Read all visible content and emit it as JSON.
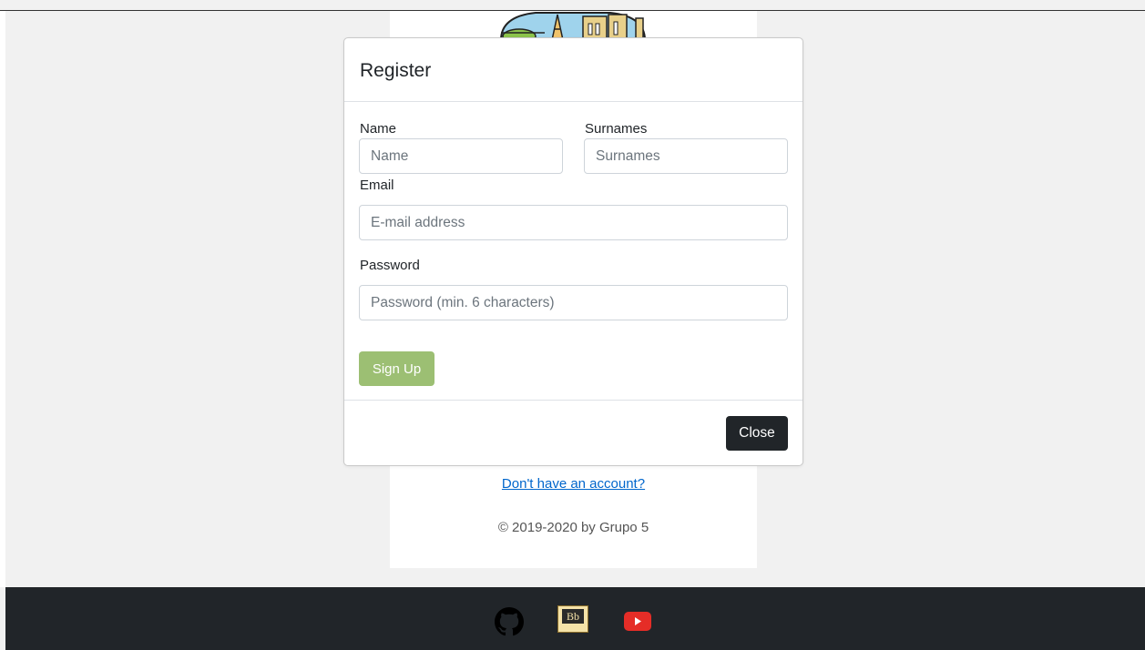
{
  "modal": {
    "title": "Register",
    "fields": {
      "name": {
        "label": "Name",
        "placeholder": "Name"
      },
      "surnames": {
        "label": "Surnames",
        "placeholder": "Surnames"
      },
      "email": {
        "label": "Email",
        "placeholder": "E-mail address"
      },
      "password": {
        "label": "Password",
        "placeholder": "Password (min. 6 characters)"
      }
    },
    "signup_label": "Sign Up",
    "close_label": "Close"
  },
  "page": {
    "account_link": "Don't have an account?",
    "copyright": "© 2019-2020 by Grupo 5"
  },
  "footer": {
    "icons": [
      "github-icon",
      "blackboard-icon",
      "youtube-icon"
    ],
    "blackboard_badge": "Bb"
  },
  "colors": {
    "signup_button": "#9cbf73",
    "close_button": "#212529",
    "footer_bg": "#212529",
    "link": "#0066cc"
  }
}
